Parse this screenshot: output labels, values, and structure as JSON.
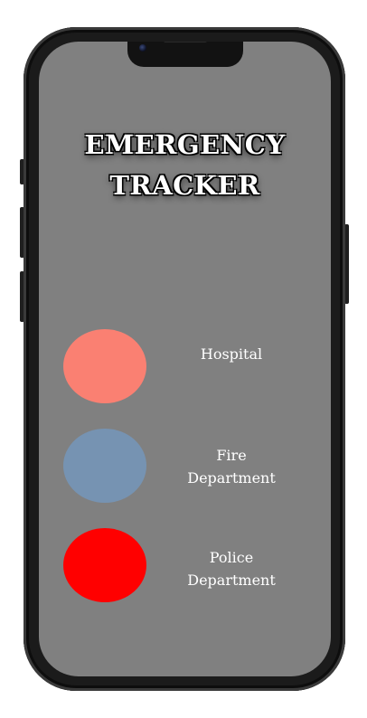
{
  "app": {
    "title_lines": [
      "EMERGENCY",
      "TRACKER"
    ]
  },
  "services": [
    {
      "lines": [
        "Hospital"
      ],
      "color": "#fa8072"
    },
    {
      "lines": [
        "Fire",
        "Department"
      ],
      "color": "#7693b2"
    },
    {
      "lines": [
        "Police",
        "Department"
      ],
      "color": "#ff0000"
    }
  ]
}
